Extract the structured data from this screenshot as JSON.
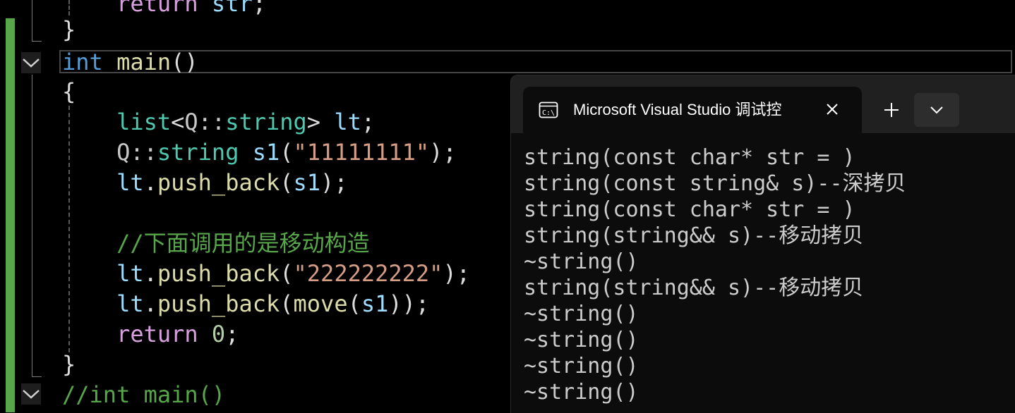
{
  "editor": {
    "lines": {
      "l1": {
        "ctl": "return",
        "sp": " ",
        "var": "str",
        "semi": ";"
      },
      "l2": {
        "brace": "}"
      },
      "l3": {
        "kw": "int",
        "sp": " ",
        "fn": "main",
        "parens": "()"
      },
      "l4": {
        "brace": "{"
      },
      "l5": {
        "ty": "list",
        "lt": "<",
        "ns": "Q::",
        "ty2": "string",
        "gt": ">",
        "sp": " ",
        "var": "lt",
        "semi": ";"
      },
      "l6": {
        "ns": "Q::",
        "ty": "string",
        "sp": " ",
        "var": "s1",
        "open": "(",
        "str": "\"11111111\"",
        "close": ");"
      },
      "l7": {
        "var": "lt",
        "dot": ".",
        "fn": "push_back",
        "open": "(",
        "var2": "s1",
        "close": ");"
      },
      "l8": {
        "comment": "//下面调用的是移动构造"
      },
      "l9": {
        "var": "lt",
        "dot": ".",
        "fn": "push_back",
        "open": "(",
        "str": "\"222222222\"",
        "close": ");"
      },
      "l10": {
        "var": "lt",
        "dot": ".",
        "fn": "push_back",
        "open": "(",
        "fn2": "move",
        "open2": "(",
        "var2": "s1",
        "close": "));"
      },
      "l11": {
        "ctl": "return",
        "sp": " ",
        "num": "0",
        "semi": ";"
      },
      "l12": {
        "brace": "}"
      },
      "l13": {
        "comment": "//int main()"
      }
    }
  },
  "terminal": {
    "tab_title": "Microsoft Visual Studio 调试控",
    "tab_icon": "console-icon",
    "close_icon": "close-icon",
    "new_tab_icon": "plus-icon",
    "dropdown_icon": "chevron-down-icon",
    "output": [
      "string(const char* str = )",
      "string(const string& s)--深拷贝",
      "string(const char* str = )",
      "string(string&& s)--移动拷贝",
      "~string()",
      "string(string&& s)--移动拷贝",
      "~string()",
      "~string()",
      "~string()",
      "~string()"
    ]
  },
  "colors": {
    "keyword": "#569cd6",
    "control": "#d8a0df",
    "function": "#dcdcaa",
    "type": "#4ec9b0",
    "variable": "#9cdcfe",
    "string": "#d69d85",
    "number": "#b5cea8",
    "comment": "#57a64a",
    "change_bar": "#57a64a",
    "terminal_bg": "#0c0c0c",
    "terminal_text": "#cccccc"
  }
}
